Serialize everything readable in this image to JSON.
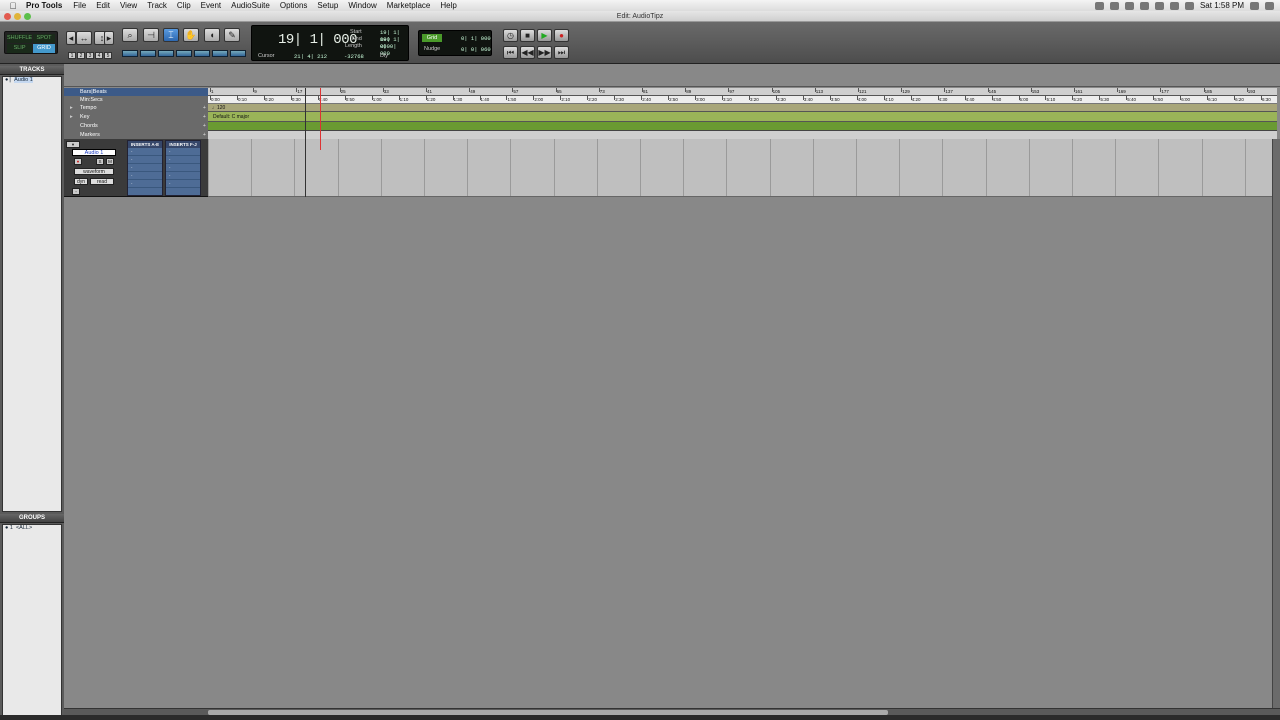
{
  "menubar": {
    "app": "Pro Tools",
    "items": [
      "File",
      "Edit",
      "View",
      "Track",
      "Clip",
      "Event",
      "AudioSuite",
      "Options",
      "Setup",
      "Window",
      "Marketplace",
      "Help"
    ],
    "clock": "Sat 1:58 PM"
  },
  "window": {
    "title": "Edit: AudioTipz"
  },
  "toolbar": {
    "modes": [
      "SHUFFLE",
      "SPOT",
      "SLIP",
      "GRID"
    ],
    "active_mode": "GRID",
    "zoom_presets": [
      "1",
      "2",
      "3",
      "4",
      "5"
    ],
    "tools": [
      "zoom-icon",
      "trim-icon",
      "selector-icon",
      "grabber-icon",
      "scrub-icon",
      "pencil-icon"
    ],
    "counter": {
      "main": "19| 1| 000",
      "start_label": "Start",
      "end_label": "End",
      "length_label": "Length",
      "start": "19| 1| 000",
      "end": "19| 1| 000",
      "length": "0| 0| 000",
      "cursor_label": "Cursor",
      "cursor": "21| 4| 212",
      "level": "-32768",
      "dly": "Dly"
    },
    "grid": {
      "label": "Grid",
      "value": "0| 1| 000",
      "nudge_label": "Nudge",
      "nudge_value": "0| 0| 060"
    }
  },
  "tracks_panel": {
    "title": "TRACKS",
    "items": [
      "Audio 1"
    ]
  },
  "groups_panel": {
    "title": "GROUPS",
    "items": [
      "<ALL>"
    ]
  },
  "rulers": {
    "labels": [
      "Bars|Beats",
      "Min:Secs",
      "Tempo",
      "Key",
      "Chords",
      "Markers"
    ],
    "bars": [
      "1",
      "9",
      "17",
      "25",
      "33",
      "41",
      "49",
      "57",
      "65",
      "73",
      "81",
      "89",
      "97",
      "105",
      "113",
      "121",
      "129",
      "137",
      "145",
      "153",
      "161",
      "169",
      "177",
      "185",
      "193"
    ],
    "mins": [
      "0:00",
      "0:10",
      "0:20",
      "0:30",
      "0:40",
      "0:50",
      "1:00",
      "1:10",
      "1:20",
      "1:30",
      "1:40",
      "1:50",
      "2:00",
      "2:10",
      "2:20",
      "2:30",
      "2:40",
      "2:50",
      "3:00",
      "3:10",
      "3:20",
      "3:30",
      "3:40",
      "3:50",
      "4:00",
      "4:10",
      "4:20",
      "4:30",
      "4:40",
      "4:50",
      "5:00",
      "5:10",
      "5:20",
      "5:30",
      "5:40",
      "5:50",
      "6:00",
      "6:10",
      "6:20",
      "6:30"
    ],
    "tempo": "120",
    "key": "Default: C major"
  },
  "track": {
    "name": "Audio 1",
    "view": "waveform",
    "dyn": "dyn",
    "automation": "read",
    "rec": "●",
    "solo": "S",
    "mute": "M",
    "inserts_ae": "INSERTS A-E",
    "inserts_fj": "INSERTS F-J"
  },
  "colors": {
    "accent": "#2d68b0",
    "tempo": "#a8a67a",
    "key": "#9ab458",
    "chords": "#6a9a32",
    "playhead": "#dd3333"
  }
}
